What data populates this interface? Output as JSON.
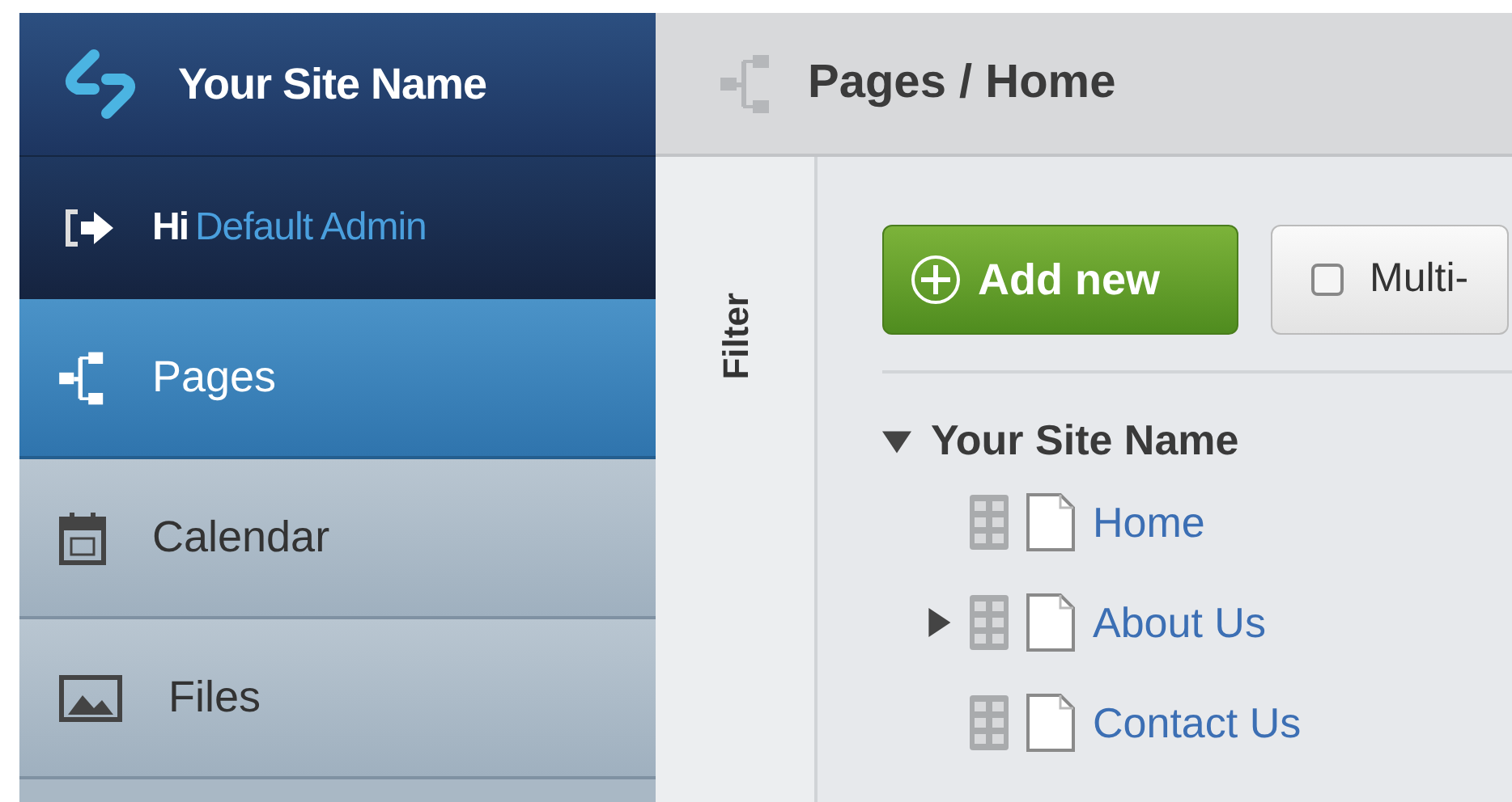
{
  "site_name": "Your Site Name",
  "greeting": {
    "prefix": "Hi",
    "user": "Default Admin"
  },
  "sidebar": {
    "items": [
      {
        "label": "Pages",
        "kind": "pages",
        "selected": true
      },
      {
        "label": "Calendar",
        "kind": "calendar",
        "selected": false
      },
      {
        "label": "Files",
        "kind": "files",
        "selected": false
      }
    ]
  },
  "breadcrumb": {
    "parent": "Pages",
    "separator": "/",
    "current": "Home"
  },
  "filter_tab": "Filter",
  "toolbar": {
    "add_button": "Add new",
    "multi_select": {
      "label": "Multi-",
      "checked": false
    }
  },
  "tree": {
    "label": "Your Site Name",
    "kind": "branch",
    "expanded": true,
    "children": [
      {
        "label": "Home",
        "kind": "leaf"
      },
      {
        "label": "About Us",
        "kind": "branch",
        "expanded": false
      },
      {
        "label": "Contact Us",
        "kind": "leaf"
      }
    ]
  }
}
